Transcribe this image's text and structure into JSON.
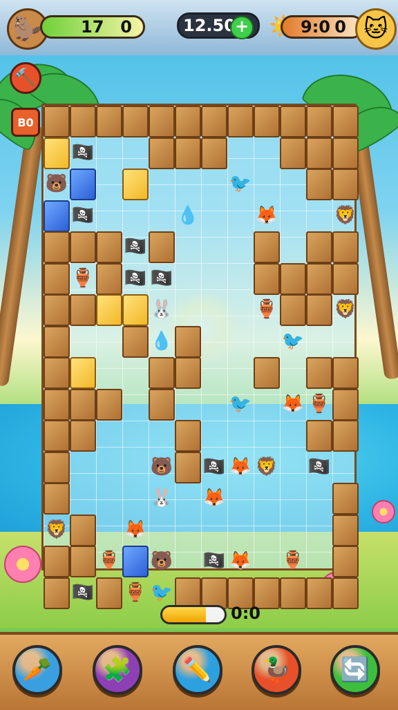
{
  "hud": {
    "left_score_a": "17",
    "left_score_b": "0",
    "timer": "12.50",
    "right_score_a": "9:0",
    "right_score_b": "0",
    "icons": {
      "left_avatar": "beaver-avatar-icon",
      "add": "plus-icon",
      "sun": "sun-icon",
      "right_avatar": "cat-avatar-icon"
    }
  },
  "side_buttons": {
    "hammer": "hammer-icon",
    "shuffle_label": "B0"
  },
  "board": {
    "pieces": [
      {
        "name": "pirate-piece",
        "glyph": "🏴‍☠️"
      },
      {
        "name": "pig-piece",
        "glyph": "🐷"
      },
      {
        "name": "bear-piece",
        "glyph": "🐻"
      },
      {
        "name": "lion-piece",
        "glyph": "🦁"
      },
      {
        "name": "rabbit-piece",
        "glyph": "🐰"
      },
      {
        "name": "pot-piece",
        "glyph": "🏺"
      },
      {
        "name": "bird-piece",
        "glyph": "🐦"
      },
      {
        "name": "blob-piece",
        "glyph": "💧"
      },
      {
        "name": "fox-piece",
        "glyph": "🦊"
      },
      {
        "name": "ghost-piece",
        "glyph": "👻"
      }
    ]
  },
  "progress": {
    "value": 0.7,
    "label": "0:0"
  },
  "tools": [
    {
      "name": "rocket-tool",
      "glyph": "🥕",
      "color": "#3a9fe0"
    },
    {
      "name": "puzzle-tool",
      "glyph": "🧩",
      "color": "#8e3fb5"
    },
    {
      "name": "pencil-tool",
      "glyph": "✏️",
      "color": "#2da0e0"
    },
    {
      "name": "duck-tool",
      "glyph": "🦆",
      "color": "#e8502a"
    },
    {
      "name": "swap-tool",
      "glyph": "🔄",
      "color": "#3cbf3c"
    }
  ]
}
